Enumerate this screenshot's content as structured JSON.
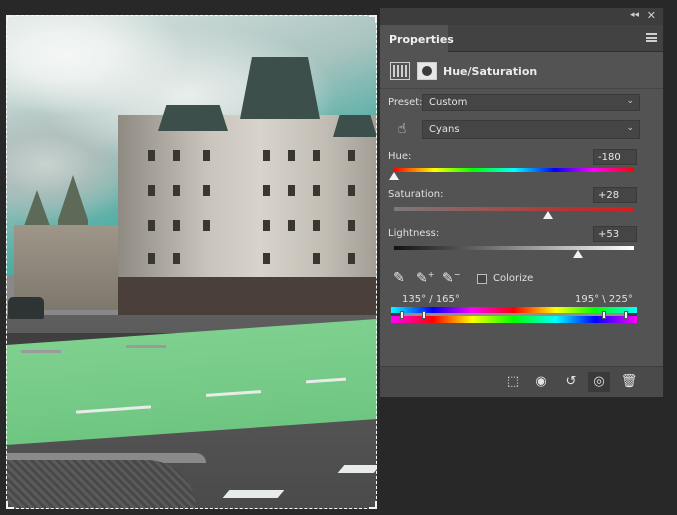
{
  "panel": {
    "tab_label": "Properties",
    "adjustment_title": "Hue/Saturation",
    "preset": {
      "label": "Preset:",
      "value": "Custom"
    },
    "channel": {
      "value": "Cyans"
    },
    "hue": {
      "label": "Hue:",
      "value": "-180",
      "slider_fraction": 0.0
    },
    "saturation": {
      "label": "Saturation:",
      "value": "+28",
      "slider_fraction": 0.64
    },
    "lightness": {
      "label": "Lightness:",
      "value": "+53",
      "slider_fraction": 0.765
    },
    "colorize": {
      "label": "Colorize",
      "checked": false
    },
    "range": {
      "left": "135° /  165°",
      "right": "195° \\  225°"
    },
    "icons": {
      "collapse": "double-chevron-icon",
      "close": "close-icon",
      "menu": "panel-menu-icon",
      "hand": "targeted-adjustment-hand-icon",
      "eyedropper": "eyedropper-icon",
      "eyedropper_plus": "eyedropper-add-icon",
      "eyedropper_minus": "eyedropper-subtract-icon",
      "clip": "clip-to-layer-icon",
      "view_previous": "view-previous-state-icon",
      "reset": "reset-icon",
      "visibility": "eye-icon",
      "delete": "trash-icon"
    }
  },
  "colors": {
    "panel_bg": "#535353",
    "app_bg": "#282828",
    "bikelane": "#6ec681"
  }
}
